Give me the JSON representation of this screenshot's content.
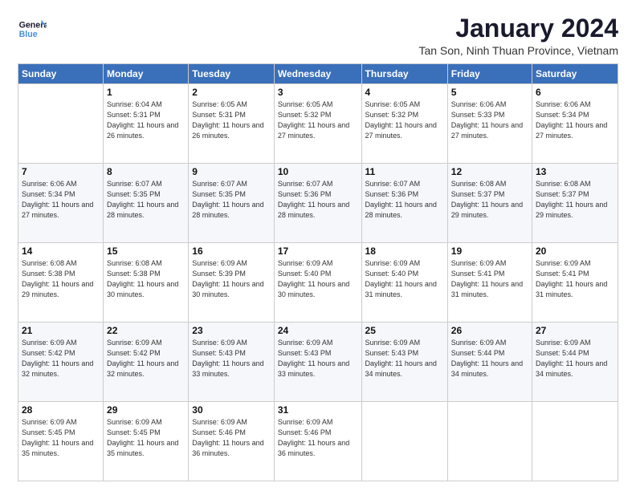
{
  "logo": {
    "line1": "General",
    "line2": "Blue"
  },
  "title": "January 2024",
  "subtitle": "Tan Son, Ninh Thuan Province, Vietnam",
  "weekdays": [
    "Sunday",
    "Monday",
    "Tuesday",
    "Wednesday",
    "Thursday",
    "Friday",
    "Saturday"
  ],
  "weeks": [
    [
      {
        "day": "",
        "sunrise": "",
        "sunset": "",
        "daylight": ""
      },
      {
        "day": "1",
        "sunrise": "Sunrise: 6:04 AM",
        "sunset": "Sunset: 5:31 PM",
        "daylight": "Daylight: 11 hours and 26 minutes."
      },
      {
        "day": "2",
        "sunrise": "Sunrise: 6:05 AM",
        "sunset": "Sunset: 5:31 PM",
        "daylight": "Daylight: 11 hours and 26 minutes."
      },
      {
        "day": "3",
        "sunrise": "Sunrise: 6:05 AM",
        "sunset": "Sunset: 5:32 PM",
        "daylight": "Daylight: 11 hours and 27 minutes."
      },
      {
        "day": "4",
        "sunrise": "Sunrise: 6:05 AM",
        "sunset": "Sunset: 5:32 PM",
        "daylight": "Daylight: 11 hours and 27 minutes."
      },
      {
        "day": "5",
        "sunrise": "Sunrise: 6:06 AM",
        "sunset": "Sunset: 5:33 PM",
        "daylight": "Daylight: 11 hours and 27 minutes."
      },
      {
        "day": "6",
        "sunrise": "Sunrise: 6:06 AM",
        "sunset": "Sunset: 5:34 PM",
        "daylight": "Daylight: 11 hours and 27 minutes."
      }
    ],
    [
      {
        "day": "7",
        "sunrise": "Sunrise: 6:06 AM",
        "sunset": "Sunset: 5:34 PM",
        "daylight": "Daylight: 11 hours and 27 minutes."
      },
      {
        "day": "8",
        "sunrise": "Sunrise: 6:07 AM",
        "sunset": "Sunset: 5:35 PM",
        "daylight": "Daylight: 11 hours and 28 minutes."
      },
      {
        "day": "9",
        "sunrise": "Sunrise: 6:07 AM",
        "sunset": "Sunset: 5:35 PM",
        "daylight": "Daylight: 11 hours and 28 minutes."
      },
      {
        "day": "10",
        "sunrise": "Sunrise: 6:07 AM",
        "sunset": "Sunset: 5:36 PM",
        "daylight": "Daylight: 11 hours and 28 minutes."
      },
      {
        "day": "11",
        "sunrise": "Sunrise: 6:07 AM",
        "sunset": "Sunset: 5:36 PM",
        "daylight": "Daylight: 11 hours and 28 minutes."
      },
      {
        "day": "12",
        "sunrise": "Sunrise: 6:08 AM",
        "sunset": "Sunset: 5:37 PM",
        "daylight": "Daylight: 11 hours and 29 minutes."
      },
      {
        "day": "13",
        "sunrise": "Sunrise: 6:08 AM",
        "sunset": "Sunset: 5:37 PM",
        "daylight": "Daylight: 11 hours and 29 minutes."
      }
    ],
    [
      {
        "day": "14",
        "sunrise": "Sunrise: 6:08 AM",
        "sunset": "Sunset: 5:38 PM",
        "daylight": "Daylight: 11 hours and 29 minutes."
      },
      {
        "day": "15",
        "sunrise": "Sunrise: 6:08 AM",
        "sunset": "Sunset: 5:38 PM",
        "daylight": "Daylight: 11 hours and 30 minutes."
      },
      {
        "day": "16",
        "sunrise": "Sunrise: 6:09 AM",
        "sunset": "Sunset: 5:39 PM",
        "daylight": "Daylight: 11 hours and 30 minutes."
      },
      {
        "day": "17",
        "sunrise": "Sunrise: 6:09 AM",
        "sunset": "Sunset: 5:40 PM",
        "daylight": "Daylight: 11 hours and 30 minutes."
      },
      {
        "day": "18",
        "sunrise": "Sunrise: 6:09 AM",
        "sunset": "Sunset: 5:40 PM",
        "daylight": "Daylight: 11 hours and 31 minutes."
      },
      {
        "day": "19",
        "sunrise": "Sunrise: 6:09 AM",
        "sunset": "Sunset: 5:41 PM",
        "daylight": "Daylight: 11 hours and 31 minutes."
      },
      {
        "day": "20",
        "sunrise": "Sunrise: 6:09 AM",
        "sunset": "Sunset: 5:41 PM",
        "daylight": "Daylight: 11 hours and 31 minutes."
      }
    ],
    [
      {
        "day": "21",
        "sunrise": "Sunrise: 6:09 AM",
        "sunset": "Sunset: 5:42 PM",
        "daylight": "Daylight: 11 hours and 32 minutes."
      },
      {
        "day": "22",
        "sunrise": "Sunrise: 6:09 AM",
        "sunset": "Sunset: 5:42 PM",
        "daylight": "Daylight: 11 hours and 32 minutes."
      },
      {
        "day": "23",
        "sunrise": "Sunrise: 6:09 AM",
        "sunset": "Sunset: 5:43 PM",
        "daylight": "Daylight: 11 hours and 33 minutes."
      },
      {
        "day": "24",
        "sunrise": "Sunrise: 6:09 AM",
        "sunset": "Sunset: 5:43 PM",
        "daylight": "Daylight: 11 hours and 33 minutes."
      },
      {
        "day": "25",
        "sunrise": "Sunrise: 6:09 AM",
        "sunset": "Sunset: 5:43 PM",
        "daylight": "Daylight: 11 hours and 34 minutes."
      },
      {
        "day": "26",
        "sunrise": "Sunrise: 6:09 AM",
        "sunset": "Sunset: 5:44 PM",
        "daylight": "Daylight: 11 hours and 34 minutes."
      },
      {
        "day": "27",
        "sunrise": "Sunrise: 6:09 AM",
        "sunset": "Sunset: 5:44 PM",
        "daylight": "Daylight: 11 hours and 34 minutes."
      }
    ],
    [
      {
        "day": "28",
        "sunrise": "Sunrise: 6:09 AM",
        "sunset": "Sunset: 5:45 PM",
        "daylight": "Daylight: 11 hours and 35 minutes."
      },
      {
        "day": "29",
        "sunrise": "Sunrise: 6:09 AM",
        "sunset": "Sunset: 5:45 PM",
        "daylight": "Daylight: 11 hours and 35 minutes."
      },
      {
        "day": "30",
        "sunrise": "Sunrise: 6:09 AM",
        "sunset": "Sunset: 5:46 PM",
        "daylight": "Daylight: 11 hours and 36 minutes."
      },
      {
        "day": "31",
        "sunrise": "Sunrise: 6:09 AM",
        "sunset": "Sunset: 5:46 PM",
        "daylight": "Daylight: 11 hours and 36 minutes."
      },
      {
        "day": "",
        "sunrise": "",
        "sunset": "",
        "daylight": ""
      },
      {
        "day": "",
        "sunrise": "",
        "sunset": "",
        "daylight": ""
      },
      {
        "day": "",
        "sunrise": "",
        "sunset": "",
        "daylight": ""
      }
    ]
  ]
}
